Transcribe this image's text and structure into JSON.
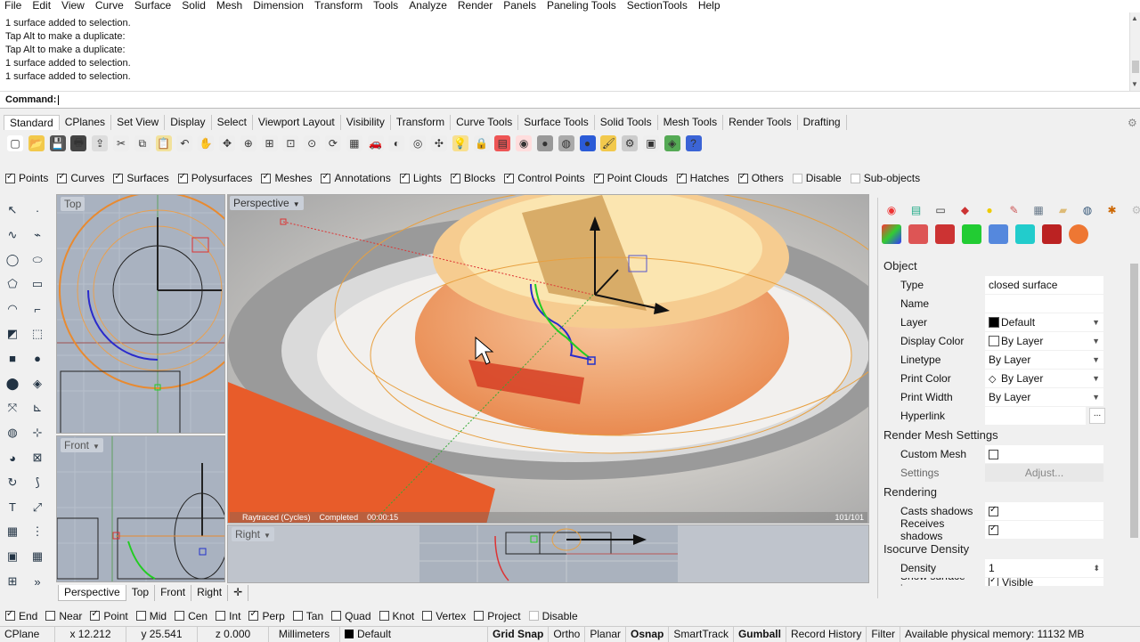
{
  "menu": [
    "File",
    "Edit",
    "View",
    "Curve",
    "Surface",
    "Solid",
    "Mesh",
    "Dimension",
    "Transform",
    "Tools",
    "Analyze",
    "Render",
    "Panels",
    "Paneling Tools",
    "SectionTools",
    "Help"
  ],
  "history": [
    "1 surface added to selection.",
    "Tap Alt to make a duplicate:",
    "Tap Alt to make a duplicate:",
    "1 surface added to selection.",
    "1 surface added to selection."
  ],
  "command": {
    "prompt": "Command:"
  },
  "toolbar_tabs": [
    "Standard",
    "CPlanes",
    "Set View",
    "Display",
    "Select",
    "Viewport Layout",
    "Visibility",
    "Transform",
    "Curve Tools",
    "Surface Tools",
    "Solid Tools",
    "Mesh Tools",
    "Render Tools",
    "Drafting"
  ],
  "toolbar_icons": [
    "new-icon",
    "open-icon",
    "save-icon",
    "print-icon",
    "import-icon",
    "cut-icon",
    "copy-icon",
    "paste-icon",
    "undo-icon",
    "pan-icon",
    "move-view-icon",
    "zoom-icon",
    "zoom-window-icon",
    "zoom-extents-icon",
    "zoom-selected-icon",
    "rotate-view-icon",
    "grid-icon",
    "car-icon",
    "shade-icon",
    "point-icon",
    "snap-icon",
    "light-icon",
    "lock-icon",
    "layer-icon",
    "color-icon",
    "sphere-icon",
    "render-sphere-icon",
    "blue-sphere-icon",
    "paint-icon",
    "gear-icon",
    "options-icon",
    "globe-icon",
    "help-icon"
  ],
  "filters": [
    {
      "label": "Points",
      "checked": true
    },
    {
      "label": "Curves",
      "checked": true
    },
    {
      "label": "Surfaces",
      "checked": true
    },
    {
      "label": "Polysurfaces",
      "checked": true
    },
    {
      "label": "Meshes",
      "checked": true
    },
    {
      "label": "Annotations",
      "checked": true
    },
    {
      "label": "Lights",
      "checked": true
    },
    {
      "label": "Blocks",
      "checked": true
    },
    {
      "label": "Control Points",
      "checked": true
    },
    {
      "label": "Point Clouds",
      "checked": true
    },
    {
      "label": "Hatches",
      "checked": true
    },
    {
      "label": "Others",
      "checked": true
    },
    {
      "label": "Disable",
      "checked": false
    },
    {
      "label": "Sub-objects",
      "checked": false
    }
  ],
  "viewports": {
    "top": "Top",
    "front": "Front",
    "perspective": "Perspective",
    "right": "Right"
  },
  "render_status": {
    "engine": "Raytraced (Cycles)",
    "state": "Completed",
    "time": "00:00:15",
    "passes": "101/101"
  },
  "viewport_tabs": [
    "Perspective",
    "Top",
    "Front",
    "Right"
  ],
  "properties": {
    "section_object": "Object",
    "type_label": "Type",
    "type_value": "closed surface",
    "name_label": "Name",
    "name_value": "",
    "layer_label": "Layer",
    "layer_value": "Default",
    "display_color_label": "Display Color",
    "display_color_value": "By Layer",
    "linetype_label": "Linetype",
    "linetype_value": "By Layer",
    "print_color_label": "Print Color",
    "print_color_value": "By Layer",
    "print_width_label": "Print Width",
    "print_width_value": "By Layer",
    "hyperlink_label": "Hyperlink",
    "hyperlink_value": "",
    "section_render_mesh": "Render Mesh Settings",
    "custom_mesh_label": "Custom Mesh",
    "settings_label": "Settings",
    "adjust_button": "Adjust...",
    "section_rendering": "Rendering",
    "casts_shadows_label": "Casts shadows",
    "receives_shadows_label": "Receives shadows",
    "section_isocurve": "Isocurve Density",
    "density_label": "Density",
    "density_value": "1",
    "show_isocurves_label": "Show surface isocu",
    "show_isocurves_value": "Visible"
  },
  "osnaps": [
    {
      "label": "End",
      "checked": true
    },
    {
      "label": "Near",
      "checked": false
    },
    {
      "label": "Point",
      "checked": true
    },
    {
      "label": "Mid",
      "checked": false
    },
    {
      "label": "Cen",
      "checked": false
    },
    {
      "label": "Int",
      "checked": false
    },
    {
      "label": "Perp",
      "checked": true
    },
    {
      "label": "Tan",
      "checked": false
    },
    {
      "label": "Quad",
      "checked": false
    },
    {
      "label": "Knot",
      "checked": false
    },
    {
      "label": "Vertex",
      "checked": false
    },
    {
      "label": "Project",
      "checked": false
    },
    {
      "label": "Disable",
      "checked": false
    }
  ],
  "status": {
    "cplane": "CPlane",
    "x": "x 12.212",
    "y": "y 25.541",
    "z": "z 0.000",
    "units": "Millimeters",
    "layer": "Default",
    "grid_snap": "Grid Snap",
    "ortho": "Ortho",
    "planar": "Planar",
    "osnap": "Osnap",
    "smarttrack": "SmartTrack",
    "gumball": "Gumball",
    "record_history": "Record History",
    "filter": "Filter",
    "memory": "Available physical memory: 11132 MB"
  },
  "colors": {
    "accent": "#f0a040",
    "render_orange": "#e85c2a",
    "curve_blue": "#2a2acc"
  }
}
